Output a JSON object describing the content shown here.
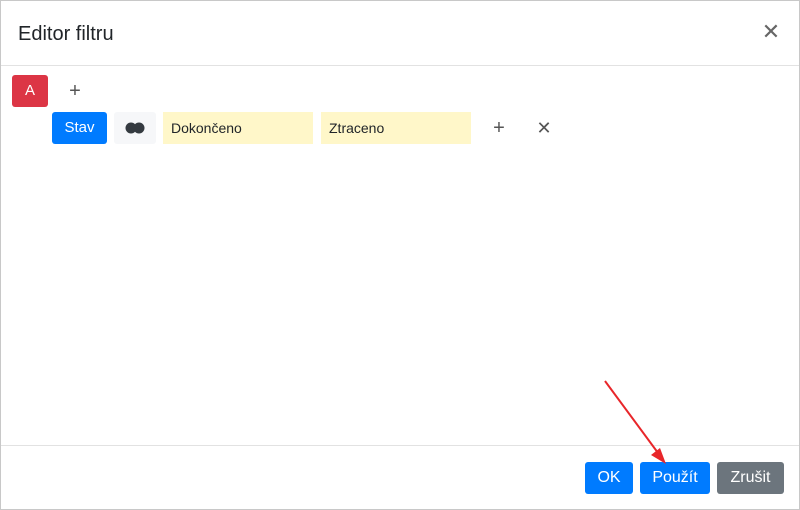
{
  "dialog": {
    "title": "Editor filtru",
    "close_icon": "close-icon"
  },
  "group": {
    "label": "A",
    "add_icon": "plus-icon"
  },
  "condition": {
    "field_label": "Stav",
    "operator_icon": "two-circles-icon",
    "values": [
      "Dokončeno",
      "Ztraceno"
    ],
    "add_icon": "plus-icon",
    "remove_icon": "close-icon"
  },
  "footer": {
    "ok_label": "OK",
    "apply_label": "Použít",
    "cancel_label": "Zrušit"
  },
  "colors": {
    "primary": "#007bff",
    "danger": "#dc3545",
    "secondary": "#6c757d",
    "value_bg": "#fff7c9",
    "annotation_arrow": "#e8262a"
  }
}
